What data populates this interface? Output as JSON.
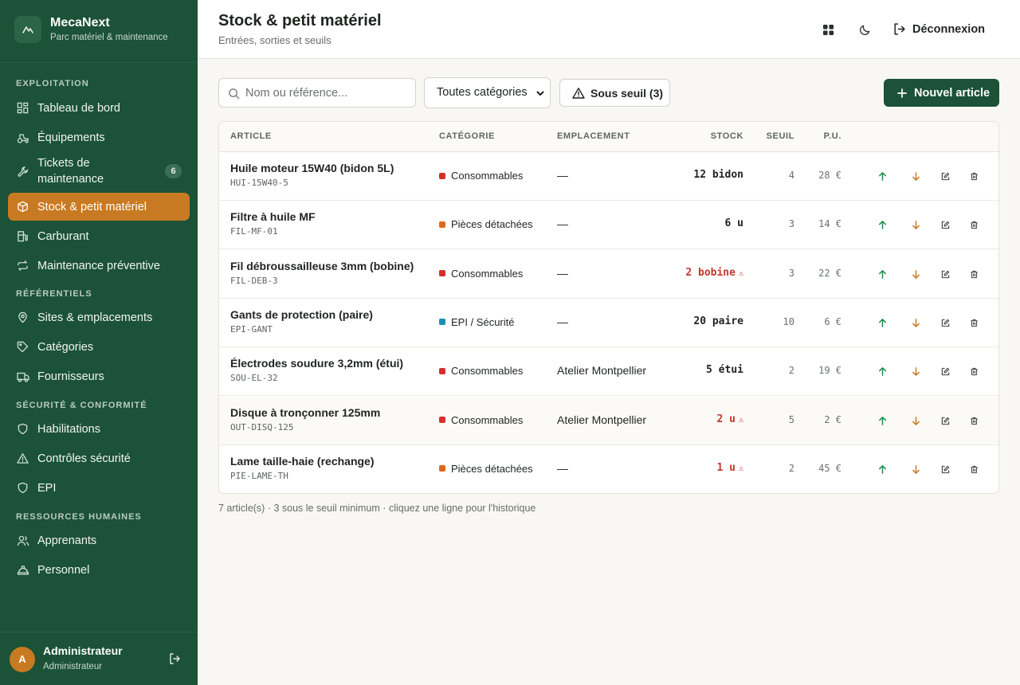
{
  "app": {
    "name": "MecaNext",
    "tagline": "Parc matériel & maintenance"
  },
  "nav": {
    "sections": [
      {
        "title": "Exploitation",
        "items": [
          {
            "label": "Tableau de bord",
            "icon": "dashboard-icon"
          },
          {
            "label": "Équipements",
            "icon": "tractor-icon"
          },
          {
            "label": "Tickets de maintenance",
            "icon": "wrench-icon",
            "badge": "6"
          },
          {
            "label": "Stock & petit matériel",
            "icon": "box-icon",
            "active": true
          },
          {
            "label": "Carburant",
            "icon": "fuel-icon"
          },
          {
            "label": "Maintenance préventive",
            "icon": "repeat-icon"
          }
        ]
      },
      {
        "title": "Référentiels",
        "items": [
          {
            "label": "Sites & emplacements",
            "icon": "map-pin-icon"
          },
          {
            "label": "Catégories",
            "icon": "tag-icon"
          },
          {
            "label": "Fournisseurs",
            "icon": "truck-icon"
          }
        ]
      },
      {
        "title": "Sécurité & conformité",
        "items": [
          {
            "label": "Habilitations",
            "icon": "shield-icon"
          },
          {
            "label": "Contrôles sécurité",
            "icon": "warning-icon"
          },
          {
            "label": "EPI",
            "icon": "shield-icon"
          }
        ]
      },
      {
        "title": "Ressources humaines",
        "items": [
          {
            "label": "Apprenants",
            "icon": "users-icon"
          },
          {
            "label": "Personnel",
            "icon": "hard-hat-icon"
          }
        ]
      }
    ]
  },
  "user": {
    "initial": "A",
    "name": "Administrateur",
    "role": "Administrateur"
  },
  "header": {
    "title": "Stock & petit matériel",
    "subtitle": "Entrées, sorties et seuils",
    "logout_label": "Déconnexion"
  },
  "toolbar": {
    "search_placeholder": "Nom ou référence...",
    "category_select": "Toutes catégories",
    "threshold_label": "Sous seuil (3)",
    "new_label": "Nouvel article"
  },
  "table": {
    "columns": {
      "article": "Article",
      "category": "Catégorie",
      "location": "Emplacement",
      "stock": "Stock",
      "threshold": "Seuil",
      "unit_price": "P.U."
    },
    "rows": [
      {
        "name": "Huile moteur 15W40 (bidon 5L)",
        "ref": "HUI-15W40-5",
        "category": "Consommables",
        "cat_color": "#d62e2e",
        "location": "—",
        "stock": "12 bidon",
        "low": false,
        "threshold": "4",
        "price": "28 €"
      },
      {
        "name": "Filtre à huile MF",
        "ref": "FIL-MF-01",
        "category": "Pièces détachées",
        "cat_color": "#e0661b",
        "location": "—",
        "stock": "6 u",
        "low": false,
        "threshold": "3",
        "price": "14 €"
      },
      {
        "name": "Fil débroussailleuse 3mm (bobine)",
        "ref": "FIL-DEB-3",
        "category": "Consommables",
        "cat_color": "#d62e2e",
        "location": "—",
        "stock": "2 bobine",
        "low": true,
        "threshold": "3",
        "price": "22 €"
      },
      {
        "name": "Gants de protection (paire)",
        "ref": "EPI-GANT",
        "category": "EPI / Sécurité",
        "cat_color": "#1a8fb5",
        "location": "—",
        "stock": "20 paire",
        "low": false,
        "threshold": "10",
        "price": "6 €"
      },
      {
        "name": "Électrodes soudure 3,2mm (étui)",
        "ref": "SOU-EL-32",
        "category": "Consommables",
        "cat_color": "#d62e2e",
        "location": "Atelier Montpellier",
        "stock": "5 étui",
        "low": false,
        "threshold": "2",
        "price": "19 €"
      },
      {
        "name": "Disque à tronçonner 125mm",
        "ref": "OUT-DISQ-125",
        "category": "Consommables",
        "cat_color": "#d62e2e",
        "location": "Atelier Montpellier",
        "stock": "2 u",
        "low": true,
        "threshold": "5",
        "price": "2 €"
      },
      {
        "name": "Lame taille-haie (rechange)",
        "ref": "PIE-LAME-TH",
        "category": "Pièces détachées",
        "cat_color": "#e0661b",
        "location": "—",
        "stock": "1 u",
        "low": true,
        "threshold": "2",
        "price": "45 €"
      }
    ]
  },
  "footer_note": "7 article(s) · 3 sous le seuil minimum · cliquez une ligne pour l'historique",
  "colors": {
    "sidebar": "#1c5238",
    "accent": "#c87a22",
    "low_stock": "#c0392b",
    "stock_in": "#1f8a4c"
  }
}
